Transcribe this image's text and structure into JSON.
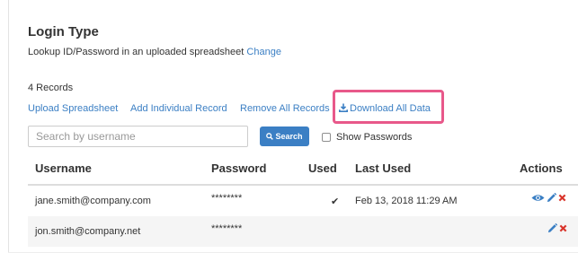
{
  "login": {
    "title": "Login Type",
    "description": "Lookup ID/Password in an uploaded spreadsheet",
    "change_link": "Change"
  },
  "records": {
    "count_label": "4 Records"
  },
  "actions": {
    "upload": "Upload Spreadsheet",
    "add": "Add Individual Record",
    "remove": "Remove All Records",
    "download": "Download All Data"
  },
  "search": {
    "placeholder": "Search by username",
    "value": "",
    "button_label": "Search",
    "show_passwords_label": "Show Passwords",
    "show_passwords_checked": false
  },
  "table": {
    "columns": [
      "Username",
      "Password",
      "Used",
      "Last Used",
      "Actions"
    ],
    "rows": [
      {
        "username": "jane.smith@company.com",
        "password": "********",
        "used": "✔",
        "last_used": "Feb 13, 2018 11:29 AM",
        "actions": [
          "view-icon",
          "edit-icon",
          "delete-icon"
        ]
      },
      {
        "username": "jon.smith@company.net",
        "password": "********",
        "used": "",
        "last_used": "",
        "actions": [
          "edit-icon",
          "delete-icon"
        ]
      }
    ]
  },
  "colors": {
    "link": "#3b7fc4",
    "highlight": "#e8588a",
    "delete": "#d9342b",
    "text": "#333333"
  }
}
